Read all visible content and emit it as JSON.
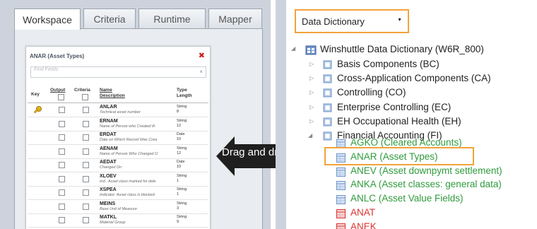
{
  "tabs": [
    {
      "label": "Workspace",
      "active": true
    },
    {
      "label": "Criteria",
      "active": false
    },
    {
      "label": "Runtime",
      "active": false
    },
    {
      "label": "Mapper",
      "active": false
    }
  ],
  "field_window": {
    "title": "ANAR (Asset Types)",
    "close_icon": "close-icon",
    "search_placeholder": "Find Fields",
    "search_clear": "×",
    "headers": {
      "key": "Key",
      "output": "Output",
      "criteria": "Criteria",
      "name": "Name",
      "description": "Description",
      "type": "Type",
      "length": "Length"
    },
    "rows": [
      {
        "name": "ANLAR",
        "desc": "Technical asset number",
        "type": "String",
        "len": "8",
        "key": true
      },
      {
        "name": "ERNAM",
        "desc": "Name of Person who Created th",
        "type": "String",
        "len": "12",
        "key": false
      },
      {
        "name": "ERDAT",
        "desc": "Date on Which Record Was Crea",
        "type": "Date",
        "len": "10",
        "key": false
      },
      {
        "name": "AENAM",
        "desc": "Name of Person Who Changed O",
        "type": "String",
        "len": "12",
        "key": false
      },
      {
        "name": "AEDAT",
        "desc": "Changed On",
        "type": "Date",
        "len": "10",
        "key": false
      },
      {
        "name": "XLOEV",
        "desc": "Ind.: Asset class marked for dele",
        "type": "String",
        "len": "1",
        "key": false
      },
      {
        "name": "XSPEA",
        "desc": "Indicator: Asset class is blocked",
        "type": "String",
        "len": "1",
        "key": false
      },
      {
        "name": "MEINS",
        "desc": "Base Unit of Measure",
        "type": "String",
        "len": "3",
        "key": false
      },
      {
        "name": "MATKL",
        "desc": "Material Group",
        "type": "String",
        "len": "9",
        "key": false
      }
    ]
  },
  "overlay": {
    "drag_label": "Drag and drop"
  },
  "dictionary": {
    "select_value": "Data Dictionary",
    "root": "Winshuttle Data Dictionary (W6R_800)",
    "folders": [
      {
        "label": "Basis Components (BC)",
        "expanded": false
      },
      {
        "label": "Cross-Application Components (CA)",
        "expanded": false
      },
      {
        "label": "Controlling (CO)",
        "expanded": false
      },
      {
        "label": "Enterprise Controlling (EC)",
        "expanded": false
      },
      {
        "label": "EH Occupational Health (EH)",
        "expanded": false
      },
      {
        "label": "Financial Accounting (FI)",
        "expanded": true
      }
    ],
    "tables": [
      {
        "label": "AGKO  (Cleared Accounts)",
        "status": "green"
      },
      {
        "label": "ANAR  (Asset Types)",
        "status": "green",
        "highlighted": true
      },
      {
        "label": "ANEV  (Asset downpymt settlement)",
        "status": "green"
      },
      {
        "label": "ANKA  (Asset classes:  general data)",
        "status": "green"
      },
      {
        "label": "ANLC  (Asset Value Fields)",
        "status": "green"
      },
      {
        "label": "ANAT",
        "status": "red"
      },
      {
        "label": "ANEK",
        "status": "red"
      }
    ]
  },
  "colors": {
    "accent_orange": "#f2a33a",
    "green_text": "#2f9b3c",
    "red_text": "#d8332e"
  }
}
